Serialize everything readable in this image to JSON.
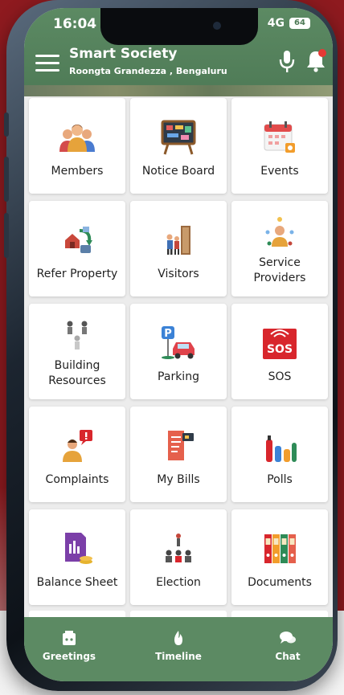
{
  "status_bar": {
    "time": "16:04",
    "network": "4G",
    "battery": "64"
  },
  "header": {
    "title": "Smart Society",
    "subtitle": "Roongta  Grandezza ,  Bengaluru"
  },
  "tiles": [
    {
      "label": "Members",
      "icon": "members-icon"
    },
    {
      "label": "Notice Board",
      "icon": "notice-board-icon"
    },
    {
      "label": "Events",
      "icon": "calendar-icon"
    },
    {
      "label": "Refer Property",
      "icon": "refer-property-icon"
    },
    {
      "label": "Visitors",
      "icon": "visitors-icon"
    },
    {
      "label": "Service Providers",
      "icon": "service-providers-icon"
    },
    {
      "label": "Building Resources",
      "icon": "building-resources-icon"
    },
    {
      "label": "Parking",
      "icon": "parking-icon"
    },
    {
      "label": "SOS",
      "icon": "sos-icon"
    },
    {
      "label": "Complaints",
      "icon": "complaints-icon"
    },
    {
      "label": "My Bills",
      "icon": "bills-icon"
    },
    {
      "label": "Polls",
      "icon": "polls-icon"
    },
    {
      "label": "Balance Sheet",
      "icon": "balance-sheet-icon"
    },
    {
      "label": "Election",
      "icon": "election-icon"
    },
    {
      "label": "Documents",
      "icon": "documents-icon"
    }
  ],
  "bottom_nav": [
    {
      "label": "Greetings",
      "icon": "greetings-icon"
    },
    {
      "label": "Timeline",
      "icon": "timeline-icon"
    },
    {
      "label": "Chat",
      "icon": "chat-icon"
    }
  ],
  "colors": {
    "brand_green": "#5c8a63",
    "background_red": "#8e1a1f",
    "sos_red": "#d8262c"
  }
}
